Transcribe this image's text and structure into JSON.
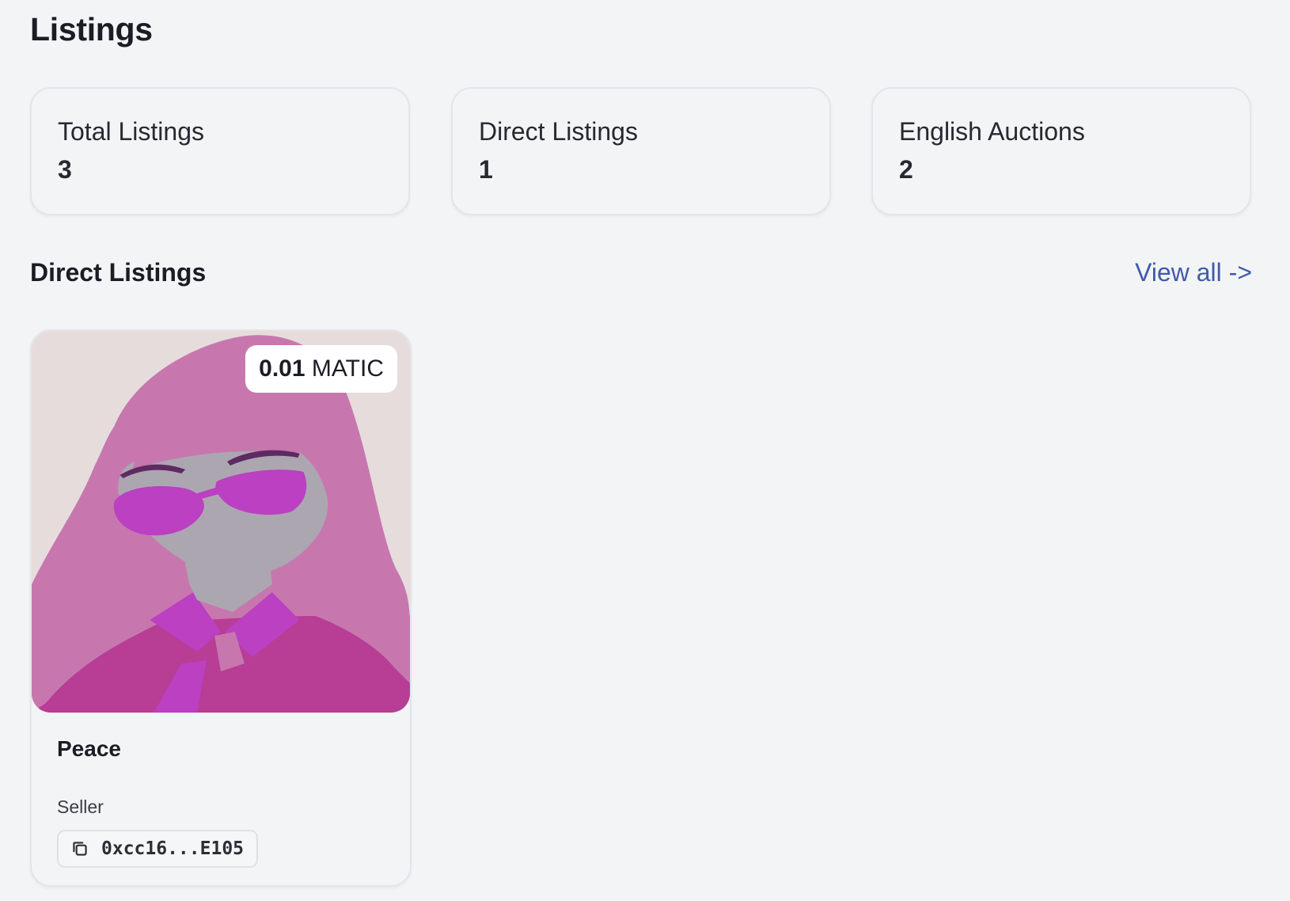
{
  "page": {
    "title": "Listings"
  },
  "stats": [
    {
      "label": "Total Listings",
      "value": "3"
    },
    {
      "label": "Direct Listings",
      "value": "1"
    },
    {
      "label": "English Auctions",
      "value": "2"
    }
  ],
  "direct_listings": {
    "title": "Direct Listings",
    "view_all": "View all ->",
    "items": [
      {
        "name": "Peace",
        "price_amount": "0.01",
        "price_currency": "MATIC",
        "seller_label": "Seller",
        "seller_address": "0xcc16...E105",
        "image": "nft-portrait-pink-hair-sunglasses",
        "copy_icon": "copy-icon"
      }
    ]
  },
  "colors": {
    "background": "#f3f4f6",
    "link": "#3f5ba9",
    "text": "#1a1d24"
  }
}
